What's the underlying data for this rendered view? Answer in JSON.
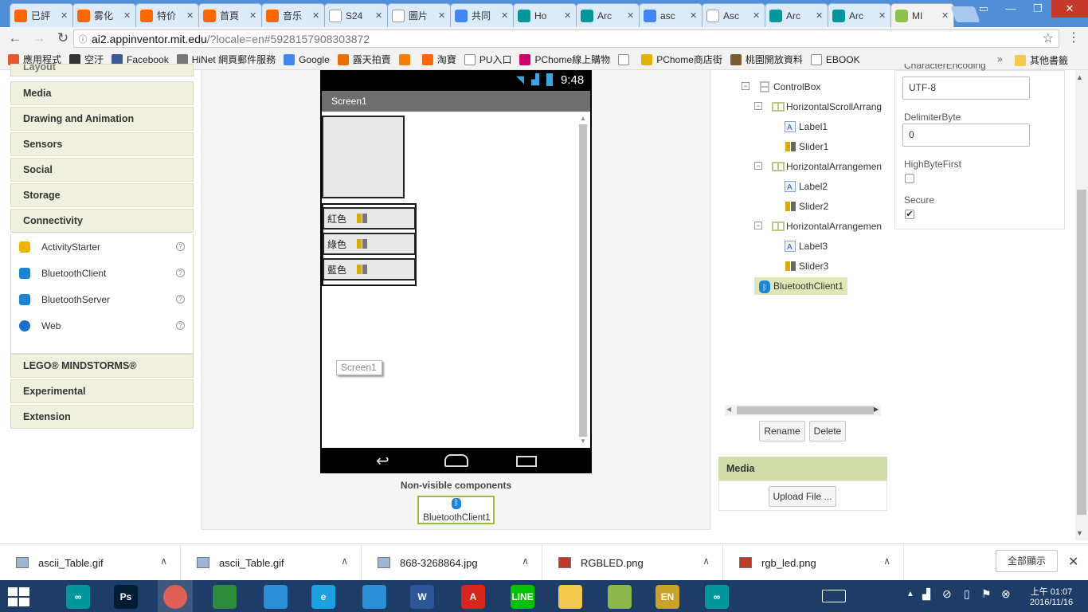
{
  "browser": {
    "tabs": [
      {
        "label": "已評",
        "icon": "taobao-icon",
        "color": "#ff6600"
      },
      {
        "label": "雾化",
        "icon": "taobao-icon",
        "color": "#ff6600"
      },
      {
        "label": "特价",
        "icon": "taobao-icon",
        "color": "#ff6600"
      },
      {
        "label": "首頁",
        "icon": "taobao-icon",
        "color": "#ff6600"
      },
      {
        "label": "音乐",
        "icon": "taobao-icon",
        "color": "#ff6600"
      },
      {
        "label": "S24",
        "icon": "page-icon",
        "color": "#ffffff"
      },
      {
        "label": "圖片",
        "icon": "page-icon",
        "color": "#ffffff"
      },
      {
        "label": "共同",
        "icon": "google-icon",
        "color": "#4285f4"
      },
      {
        "label": "Ho",
        "icon": "arduino-icon",
        "color": "#00979c"
      },
      {
        "label": "Arc",
        "icon": "arduino-icon",
        "color": "#00979c"
      },
      {
        "label": "asc",
        "icon": "google-icon",
        "color": "#4285f4"
      },
      {
        "label": "Asc",
        "icon": "page-icon",
        "color": "#ffffff"
      },
      {
        "label": "Arc",
        "icon": "arduino-icon",
        "color": "#00979c"
      },
      {
        "label": "Arc",
        "icon": "arduino-icon",
        "color": "#00979c"
      },
      {
        "label": "MI",
        "icon": "appinventor-icon",
        "color": "#8bc34a"
      }
    ],
    "url_host": "ai2.appinventor.mit.edu",
    "url_rest": "/?locale=en#5928157908303872",
    "bookmarks": [
      {
        "label": "應用程式",
        "icon": "apps-grid-icon",
        "color": "#e25b2c"
      },
      {
        "label": "空汙",
        "icon": "leaf-icon",
        "color": "#333333"
      },
      {
        "label": "Facebook",
        "icon": "facebook-icon",
        "color": "#3b5998"
      },
      {
        "label": "HiNet 網頁郵件服務",
        "icon": "mail-icon",
        "color": "#777777"
      },
      {
        "label": "Google",
        "icon": "google-icon",
        "color": "#4285f4"
      },
      {
        "label": "露天拍賣",
        "icon": "ruten-icon",
        "color": "#e86f00"
      },
      {
        "label": "",
        "icon": "blogger-icon",
        "color": "#f57d00"
      },
      {
        "label": "淘寶",
        "icon": "taobao-icon",
        "color": "#ff6600"
      },
      {
        "label": "PU入口",
        "icon": "page-icon",
        "color": "#ffffff"
      },
      {
        "label": "PChome線上購物",
        "icon": "pchome-icon",
        "color": "#cc0066"
      },
      {
        "label": "",
        "icon": "page-icon",
        "color": "#ffffff"
      },
      {
        "label": "PChome商店街",
        "icon": "pchome-store-icon",
        "color": "#e2b100"
      },
      {
        "label": "桃園開放資料",
        "icon": "taoyuan-icon",
        "color": "#7a5c2e"
      },
      {
        "label": "EBOOK",
        "icon": "page-icon",
        "color": "#ffffff"
      }
    ],
    "other_bookmarks": "其他書籤"
  },
  "palette": {
    "partial_header": "Layout",
    "categories_top": [
      "Media",
      "Drawing and Animation",
      "Sensors",
      "Social",
      "Storage",
      "Connectivity"
    ],
    "connectivity_items": [
      {
        "label": "ActivityStarter",
        "icon": "lightning-icon"
      },
      {
        "label": "BluetoothClient",
        "icon": "bluetooth-icon"
      },
      {
        "label": "BluetoothServer",
        "icon": "bluetooth-icon"
      },
      {
        "label": "Web",
        "icon": "globe-icon"
      }
    ],
    "help": "?",
    "categories_bottom": [
      "LEGO® MINDSTORMS®",
      "Experimental",
      "Extension"
    ]
  },
  "phone": {
    "time": "9:48",
    "screen_title": "Screen1",
    "rows": [
      {
        "label": "紅色"
      },
      {
        "label": "綠色"
      },
      {
        "label": "藍色"
      }
    ],
    "screen_tag": "Screen1"
  },
  "nonvisible": {
    "title": "Non-visible components",
    "item": "BluetoothClient1"
  },
  "components": {
    "tree": [
      {
        "label": "ControlBox",
        "icon": "vertical-arrangement-icon",
        "level": 0,
        "toggle": "⊟"
      },
      {
        "label": "HorizontalScrollArrang",
        "icon": "horizontal-arrangement-icon",
        "level": 1,
        "toggle": "⊟"
      },
      {
        "label": "Label1",
        "icon": "label-icon",
        "level": 2
      },
      {
        "label": "Slider1",
        "icon": "slider-icon",
        "level": 2
      },
      {
        "label": "HorizontalArrangemen",
        "icon": "horizontal-arrangement-icon",
        "level": 1,
        "toggle": "⊟"
      },
      {
        "label": "Label2",
        "icon": "label-icon",
        "level": 2
      },
      {
        "label": "Slider2",
        "icon": "slider-icon",
        "level": 2
      },
      {
        "label": "HorizontalArrangemen",
        "icon": "horizontal-arrangement-icon",
        "level": 1,
        "toggle": "⊟"
      },
      {
        "label": "Label3",
        "icon": "label-icon",
        "level": 2
      },
      {
        "label": "Slider3",
        "icon": "slider-icon",
        "level": 2
      },
      {
        "label": "BluetoothClient1",
        "icon": "bluetooth-icon",
        "level": 0,
        "selected": true
      }
    ],
    "rename": "Rename",
    "delete": "Delete"
  },
  "media": {
    "title": "Media",
    "upload": "Upload File ..."
  },
  "properties": {
    "partial_label": "CharacterEncoding",
    "encoding_value": "UTF-8",
    "delimiter_label": "DelimiterByte",
    "delimiter_value": "0",
    "highbyte_label": "HighByteFirst",
    "highbyte_checked": false,
    "secure_label": "Secure",
    "secure_checked": true
  },
  "downloads": {
    "items": [
      {
        "name": "ascii_Table.gif",
        "icon": "image-file-icon"
      },
      {
        "name": "ascii_Table.gif",
        "icon": "image-file-icon"
      },
      {
        "name": "868-3268864.jpg",
        "icon": "image-file-icon"
      },
      {
        "name": "RGBLED.png",
        "icon": "png-file-icon"
      },
      {
        "name": "rgb_led.png",
        "icon": "png-file-icon"
      }
    ],
    "show_all": "全部顯示"
  },
  "taskbar": {
    "apps": [
      {
        "icon": "arduino-icon",
        "color": "#00979c",
        "text": "∞"
      },
      {
        "icon": "photoshop-icon",
        "color": "#001d34",
        "text": "Ps"
      },
      {
        "icon": "chrome-icon",
        "color": "#db4437",
        "text": ""
      },
      {
        "icon": "store-icon",
        "color": "#2d8c3c",
        "text": ""
      },
      {
        "icon": "droplet-app-icon",
        "color": "#2a8fd6",
        "text": ""
      },
      {
        "icon": "ie-icon",
        "color": "#1ba1e2",
        "text": "e"
      },
      {
        "icon": "network-app-icon",
        "color": "#2a8fd6",
        "text": ""
      },
      {
        "icon": "word-icon",
        "color": "#2b579a",
        "text": "W"
      },
      {
        "icon": "acrobat-icon",
        "color": "#d9261c",
        "text": "A"
      },
      {
        "icon": "line-icon",
        "color": "#00c300",
        "text": "LINE"
      },
      {
        "icon": "file-explorer-icon",
        "color": "#f2c94c",
        "text": ""
      },
      {
        "icon": "chart-app-icon",
        "color": "#8bb64a",
        "text": ""
      },
      {
        "icon": "language-bar-icon",
        "color": "#c9a227",
        "text": "EN"
      },
      {
        "icon": "arduino-icon",
        "color": "#00979c",
        "text": "∞"
      }
    ],
    "time": "上午 01:07",
    "date": "2016/11/16"
  }
}
